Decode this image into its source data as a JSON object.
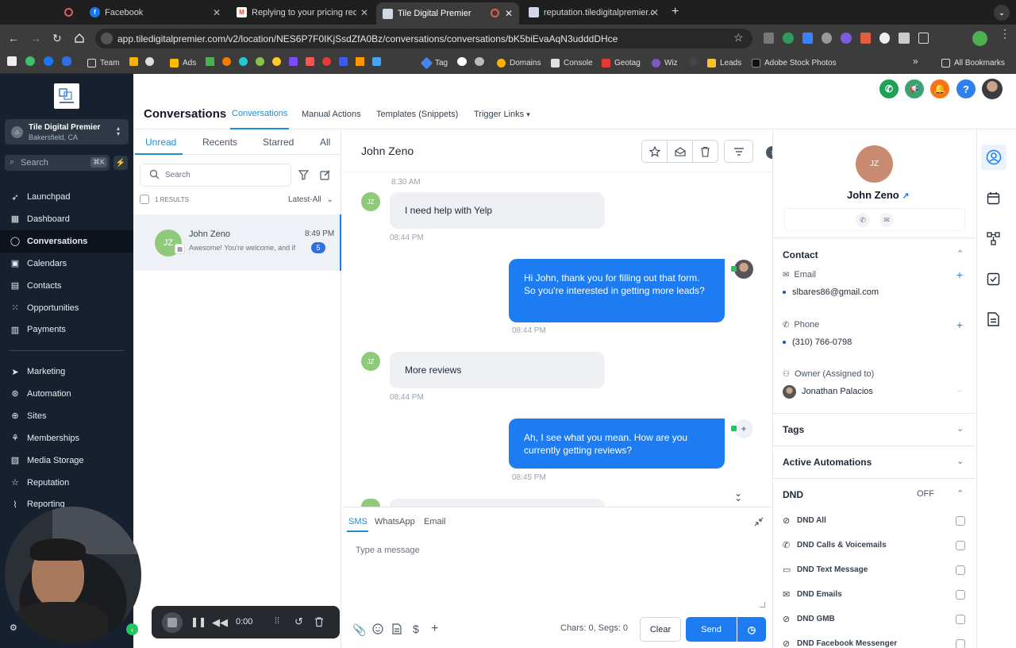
{
  "browser": {
    "tabs": [
      {
        "label": "Facebook",
        "icon": "facebook-icon"
      },
      {
        "label": "Replying to your pricing requ",
        "icon": "gmail-icon"
      },
      {
        "label": "Tile Digital Premier",
        "icon": "page-icon"
      },
      {
        "label": "reputation.tiledigitalpremier.c",
        "icon": "page-icon"
      }
    ],
    "url": "app.tiledigitalpremier.com/v2/location/NES6P7F0IKjSsdZfA0Bz/conversations/conversations/bK5biEvaAqN3udddDHce",
    "bookmarks": [
      "Team",
      "Ads",
      "Tag",
      "Domains",
      "Console",
      "Geotag",
      "Wiz",
      "Leads",
      "Adobe Stock Photos"
    ],
    "all_bookmarks": "All Bookmarks"
  },
  "sidebar": {
    "account_name": "Tile Digital Premier",
    "account_location": "Bakersfield, CA",
    "search_placeholder": "Search",
    "search_shortcut": "⌘K",
    "items": [
      {
        "label": "Launchpad",
        "icon": "rocket-icon"
      },
      {
        "label": "Dashboard",
        "icon": "grid-icon"
      },
      {
        "label": "Conversations",
        "icon": "chat-icon"
      },
      {
        "label": "Calendars",
        "icon": "calendar-icon"
      },
      {
        "label": "Contacts",
        "icon": "contacts-icon"
      },
      {
        "label": "Opportunities",
        "icon": "funnel-icon"
      },
      {
        "label": "Payments",
        "icon": "receipt-icon"
      }
    ],
    "items2": [
      {
        "label": "Marketing",
        "icon": "send-icon"
      },
      {
        "label": "Automation",
        "icon": "automation-icon"
      },
      {
        "label": "Sites",
        "icon": "globe-icon"
      },
      {
        "label": "Memberships",
        "icon": "membership-icon"
      },
      {
        "label": "Media Storage",
        "icon": "image-icon"
      },
      {
        "label": "Reputation",
        "icon": "star-icon"
      },
      {
        "label": "Reporting",
        "icon": "chart-icon"
      }
    ]
  },
  "header": {
    "title": "Conversations",
    "tabs": [
      "Conversations",
      "Manual Actions",
      "Templates (Snippets)",
      "Trigger Links"
    ]
  },
  "list": {
    "tabs": [
      "Unread",
      "Recents",
      "Starred",
      "All"
    ],
    "search_placeholder": "Search",
    "results": "1 RESULTS",
    "sort": "Latest-All",
    "items": [
      {
        "initials": "JZ",
        "name": "John Zeno",
        "time": "8:49 PM",
        "preview": "Awesome! You're welcome, and if",
        "unread": "5"
      }
    ]
  },
  "thread": {
    "contact_name": "John Zeno",
    "top_time": "8:30 AM",
    "messages": [
      {
        "dir": "in",
        "text": "I need help with Yelp",
        "time": "08:44 PM"
      },
      {
        "dir": "out",
        "text": "Hi John, thank you for filling out that form. So you're interested in getting more leads?",
        "time": "08:44 PM"
      },
      {
        "dir": "in",
        "text": "More reviews",
        "time": "08:44 PM"
      },
      {
        "dir": "out",
        "text": "Ah, I see what you mean. How are you currently getting reviews?",
        "time": "08:45 PM"
      }
    ]
  },
  "composer": {
    "channels": [
      "SMS",
      "WhatsApp",
      "Email"
    ],
    "placeholder": "Type a message",
    "counter": "Chars: 0, Segs: 0",
    "clear": "Clear",
    "send": "Send"
  },
  "contact_panel": {
    "initials": "JZ",
    "name": "John Zeno",
    "contact_label": "Contact",
    "email_label": "Email",
    "email": "slbares86@gmail.com",
    "phone_label": "Phone",
    "phone": "(310) 766-0798",
    "owner_label": "Owner (Assigned to)",
    "owner": "Jonathan Palacios",
    "tags_label": "Tags",
    "automations_label": "Active Automations",
    "dnd_label": "DND",
    "dnd_state": "OFF",
    "dnd_items": [
      "DND All",
      "DND Calls & Voicemails",
      "DND Text Message",
      "DND Emails",
      "DND GMB",
      "DND Facebook Messenger"
    ]
  },
  "recorder": {
    "time": "0:00"
  },
  "colors": {
    "accent": "#1d7cf2",
    "sidebar": "#16202e",
    "green": "#22a05a",
    "orange": "#f97316"
  }
}
